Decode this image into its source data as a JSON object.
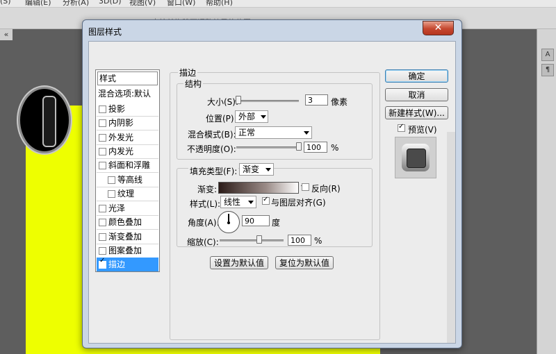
{
  "menubar": {
    "items": [
      "(S)",
      "编辑(E)",
      "分析(A)",
      "3D(D)",
      "视图(V)",
      "窗口(W)",
      "帮助(H)"
    ]
  },
  "optionsbar": {
    "hint": "点按并拖移可调整效果的位置。"
  },
  "panel_right": {
    "icons": [
      "A",
      "¶"
    ]
  },
  "dialog": {
    "title": "图层样式",
    "close_label": "✕",
    "styles_header": "样式",
    "blend_options": "混合选项:默认",
    "styles": [
      {
        "label": "投影",
        "checked": false,
        "indent": false
      },
      {
        "label": "内阴影",
        "checked": false,
        "indent": false
      },
      {
        "label": "外发光",
        "checked": false,
        "indent": false
      },
      {
        "label": "内发光",
        "checked": false,
        "indent": false
      },
      {
        "label": "斜面和浮雕",
        "checked": false,
        "indent": false
      },
      {
        "label": "等高线",
        "checked": false,
        "indent": true
      },
      {
        "label": "纹理",
        "checked": false,
        "indent": true
      },
      {
        "label": "光泽",
        "checked": false,
        "indent": false
      },
      {
        "label": "颜色叠加",
        "checked": false,
        "indent": false
      },
      {
        "label": "渐变叠加",
        "checked": false,
        "indent": false
      },
      {
        "label": "图案叠加",
        "checked": false,
        "indent": false
      },
      {
        "label": "描边",
        "checked": true,
        "indent": false,
        "selected": true
      }
    ],
    "stroke": {
      "group_title": "描边",
      "structure_title": "结构",
      "size_label": "大小(S):",
      "size_value": "3",
      "size_unit": "像素",
      "position_label": "位置(P):",
      "position_value": "外部",
      "blend_mode_label": "混合模式(B):",
      "blend_mode_value": "正常",
      "opacity_label": "不透明度(O):",
      "opacity_value": "100",
      "opacity_unit": "%",
      "fill_type_label": "填充类型(F):",
      "fill_type_value": "渐变",
      "gradient_label": "渐变:",
      "reverse_label": "反向(R)",
      "reverse_checked": false,
      "style_label": "样式(L):",
      "style_value": "线性",
      "align_label": "与图层对齐(G)",
      "align_checked": true,
      "angle_label": "角度(A):",
      "angle_value": "90",
      "angle_unit": "度",
      "scale_label": "缩放(C):",
      "scale_value": "100",
      "scale_unit": "%",
      "set_default_label": "设置为默认值",
      "reset_default_label": "复位为默认值"
    },
    "buttons": {
      "ok_label": "确定",
      "cancel_label": "取消",
      "new_style_label": "新建样式(W)...",
      "preview_label": "预览(V)",
      "preview_checked": true
    }
  }
}
